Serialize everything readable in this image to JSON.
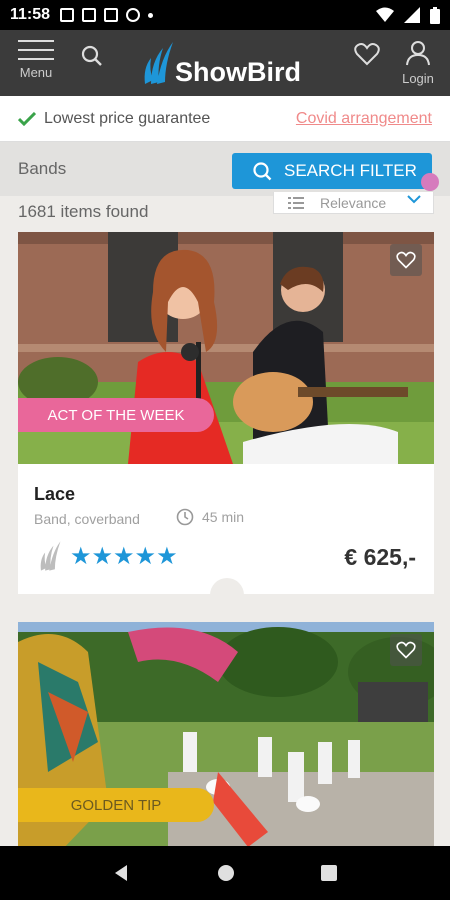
{
  "status_bar": {
    "time": "11:58"
  },
  "header": {
    "menu_label": "Menu",
    "logo_text": "ShowBird",
    "login_label": "Login"
  },
  "guarantee": {
    "text": "Lowest price guarantee",
    "covid_link": "Covid arrangement"
  },
  "filter": {
    "category": "Bands",
    "search_button": "SEARCH FILTER"
  },
  "results": {
    "count_text": "1681 items found",
    "sort_value": "Relevance"
  },
  "cards": [
    {
      "ribbon": "ACT OF THE WEEK",
      "title": "Lace",
      "subtitle": "Band, coverband",
      "duration": "45 min",
      "rating": 5,
      "stars": "★★★★★",
      "price": "€ 625,-"
    },
    {
      "ribbon": "GOLDEN TIP"
    }
  ],
  "colors": {
    "accent_blue": "#1e96d8",
    "header_bg": "#3b3b3b",
    "ribbon_pink": "#e9679a",
    "ribbon_gold": "#e9b71b",
    "covid_link": "#f08a8a"
  }
}
